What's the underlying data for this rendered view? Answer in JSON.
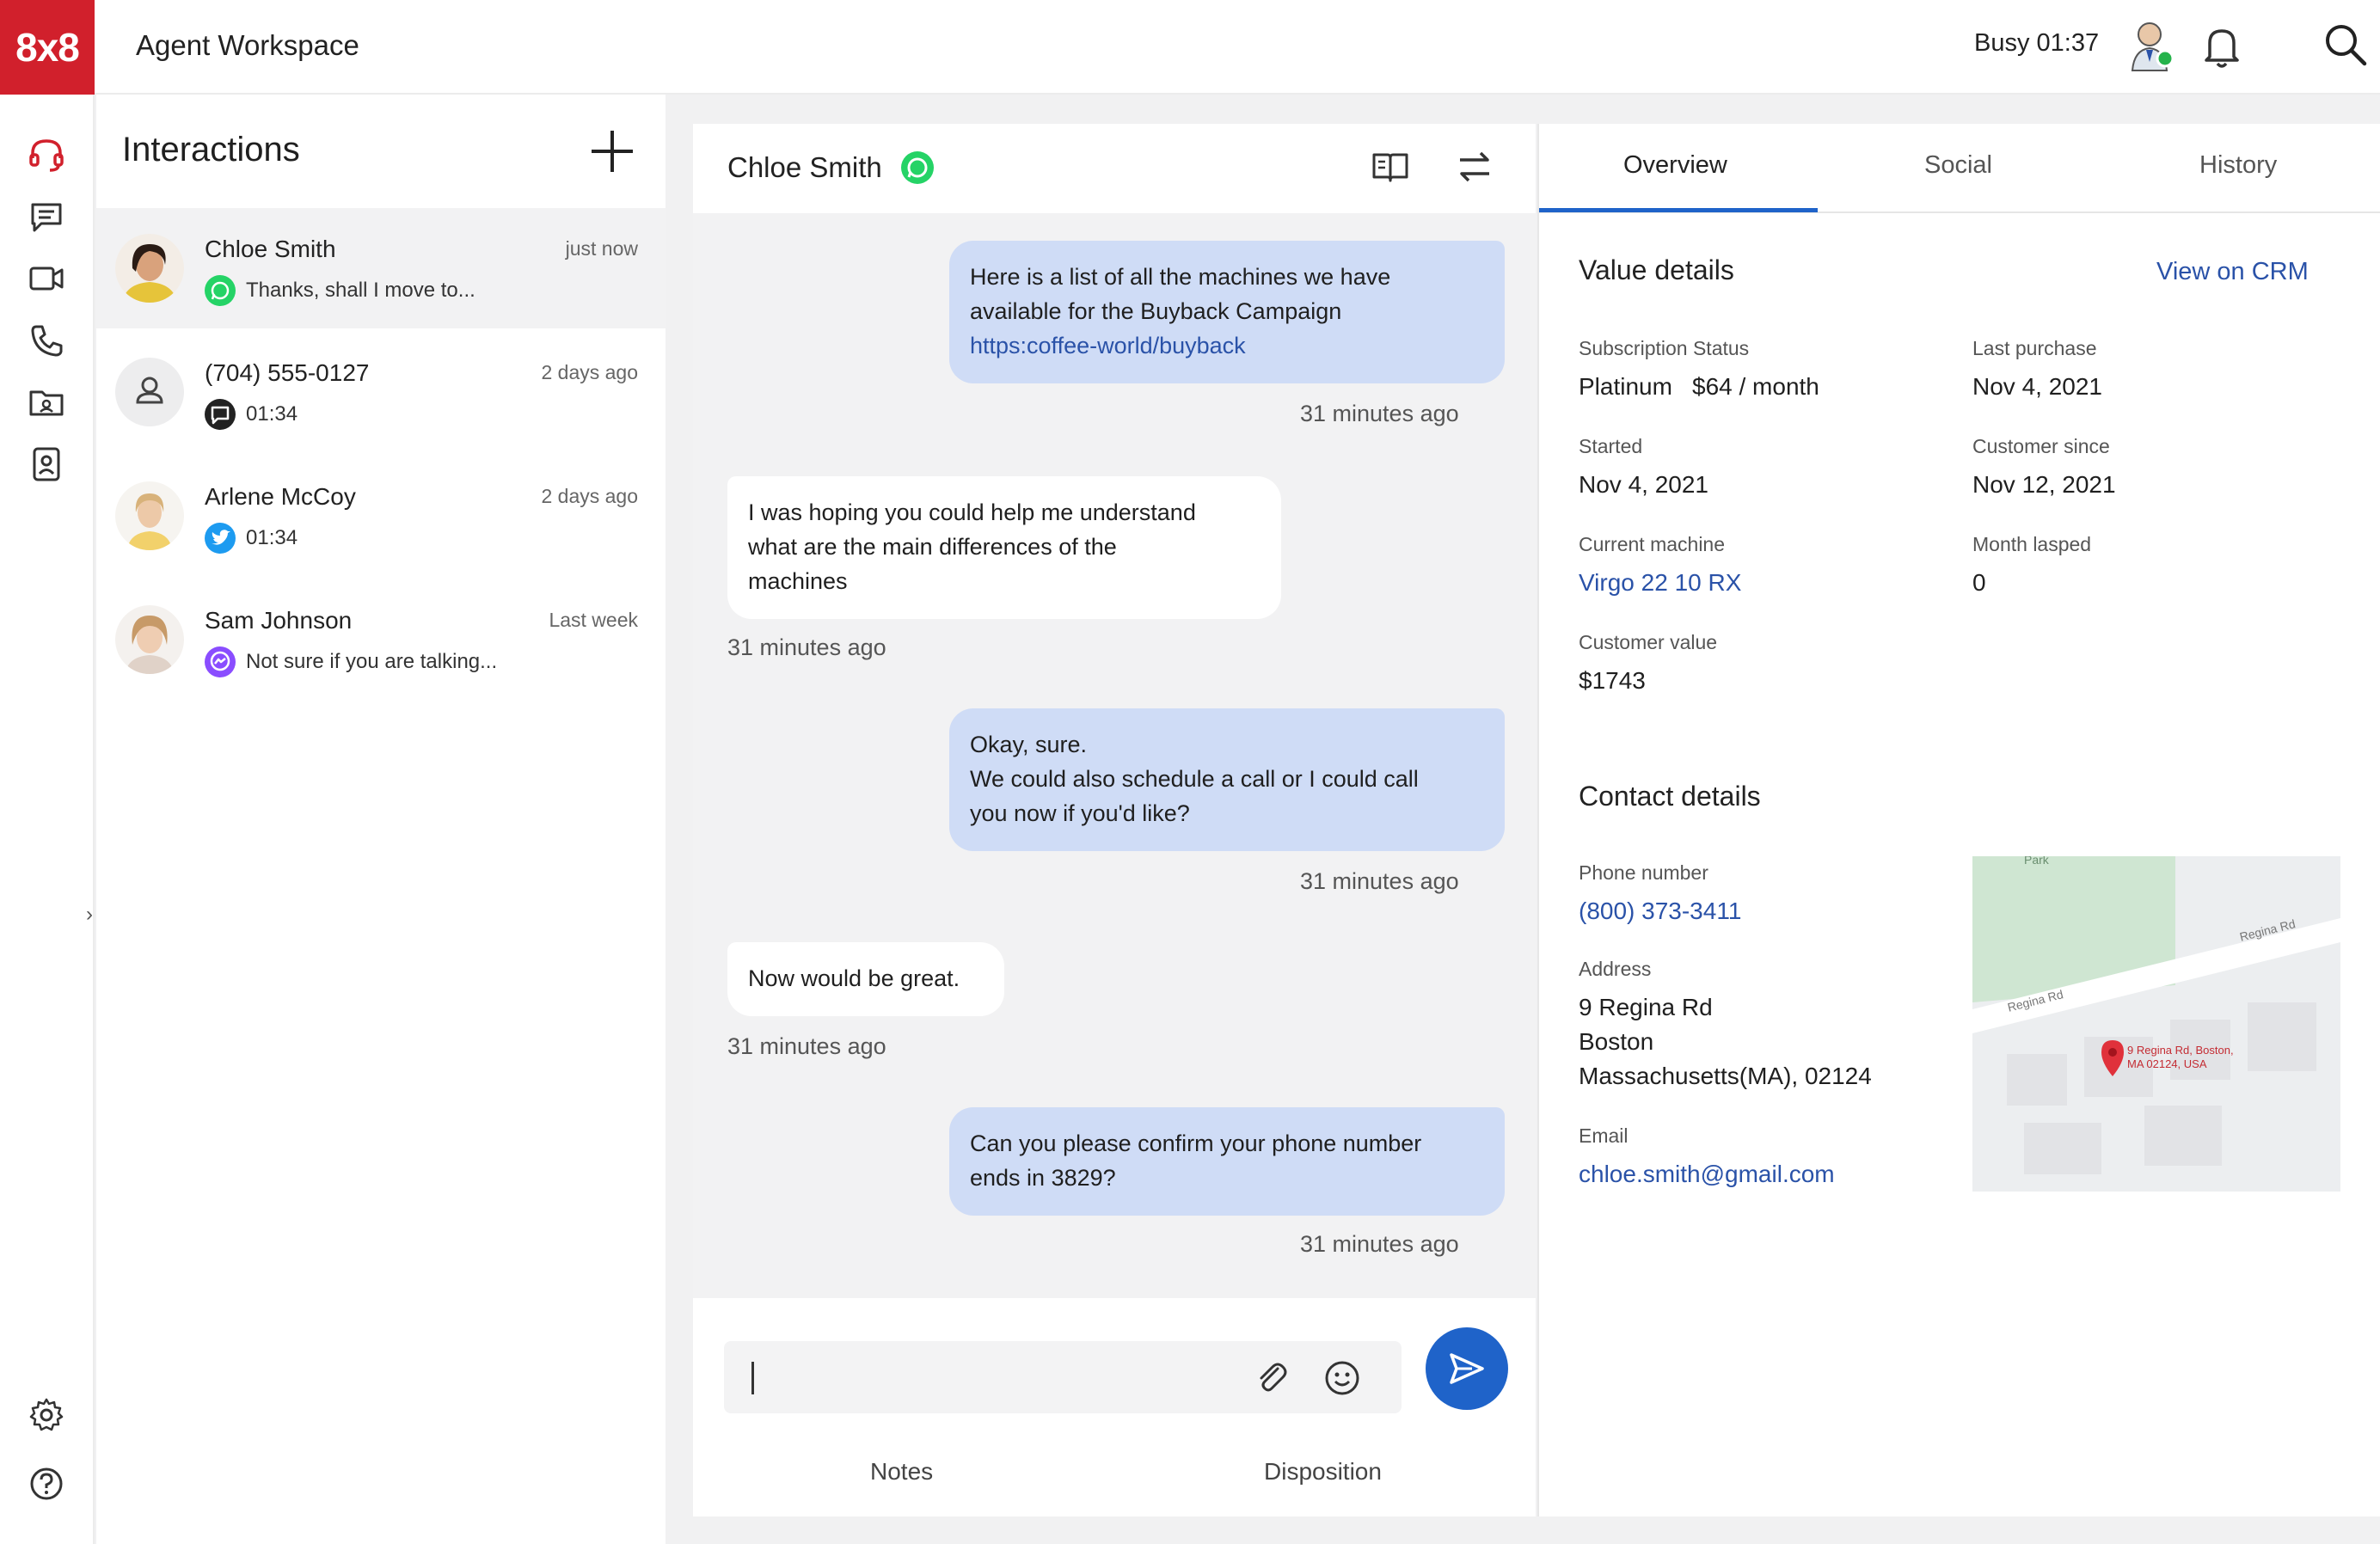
{
  "app": {
    "logo": "8x8",
    "title": "Agent Workspace",
    "status": "Busy 01:37"
  },
  "icons": {
    "user_status": "agent-avatar-icon",
    "notifications": "bell-icon",
    "search": "search-icon"
  },
  "rail": {
    "items": [
      "headset-icon",
      "chat-icon",
      "video-icon",
      "phone-icon",
      "folder-icon",
      "contacts-icon",
      "settings-icon",
      "help-icon"
    ]
  },
  "interactions": {
    "title": "Interactions",
    "items": [
      {
        "name": "Chloe Smith",
        "time": "just now",
        "channel": "whatsapp",
        "preview": "Thanks, shall I move to..."
      },
      {
        "name": "(704) 555-0127",
        "time": "2 days ago",
        "channel": "sms",
        "preview": "01:34"
      },
      {
        "name": "Arlene McCoy",
        "time": "2 days ago",
        "channel": "twitter",
        "preview": "01:34"
      },
      {
        "name": "Sam Johnson",
        "time": "Last week",
        "channel": "messenger",
        "preview": "Not sure if you are talking..."
      }
    ]
  },
  "chat": {
    "contact": "Chloe Smith",
    "messages": [
      {
        "dir": "out",
        "lines": [
          "Here is a list of all the machines we have",
          "available for the Buyback Campaign"
        ],
        "link": "https:coffee-world/buyback",
        "time": "31 minutes ago"
      },
      {
        "dir": "in",
        "lines": [
          "I was hoping you could help me understand",
          "what are the main differences of the",
          "machines"
        ],
        "time": "31 minutes ago"
      },
      {
        "dir": "out",
        "lines": [
          "Okay, sure.",
          "We could also schedule a call or I could call",
          "you now if you'd like?"
        ],
        "time": "31 minutes ago"
      },
      {
        "dir": "in",
        "lines": [
          "Now would be great."
        ],
        "time": "31 minutes ago"
      },
      {
        "dir": "out",
        "lines": [
          "Can you please confirm your phone number",
          "ends in 3829?"
        ],
        "time": "31 minutes ago"
      }
    ],
    "composer": {
      "value": "",
      "notes_tab": "Notes",
      "disposition_tab": "Disposition"
    }
  },
  "details": {
    "tabs": [
      "Overview",
      "Social",
      "History"
    ],
    "active_tab": "Overview",
    "value_section": {
      "title": "Value details",
      "crm_link": "View on CRM",
      "subscription_status_label": "Subscription Status",
      "subscription_status_value": "Platinum",
      "subscription_price": "$64 / month",
      "last_purchase_label": "Last purchase",
      "last_purchase_value": "Nov 4, 2021",
      "started_label": "Started",
      "started_value": "Nov 4, 2021",
      "customer_since_label": "Customer since",
      "customer_since_value": "Nov 12, 2021",
      "current_machine_label": "Current machine",
      "current_machine_value": "Virgo 22 10 RX",
      "month_lapsed_label": "Month lasped",
      "month_lapsed_value": "0",
      "customer_value_label": "Customer value",
      "customer_value_value": "$1743"
    },
    "contact_section": {
      "title": "Contact details",
      "phone_label": "Phone number",
      "phone_value": "(800) 373-3411",
      "address_label": "Address",
      "address_lines": [
        "9 Regina Rd",
        "Boston",
        "Massachusetts(MA), 02124"
      ],
      "email_label": "Email",
      "email_value": "chloe.smith@gmail.com"
    },
    "map": {
      "park_label": "Park",
      "road_label_1": "Regina Rd",
      "road_label_2": "Regina Rd",
      "pin_line_1": "9 Regina Rd, Boston,",
      "pin_line_2": "MA 02124, USA"
    }
  },
  "colors": {
    "brand": "#d1202c",
    "accent": "#1f63c9",
    "link": "#2a52a8",
    "outgoing_bubble": "#cfdcf6",
    "whatsapp": "#25d366",
    "twitter": "#1d9bf0",
    "messenger": "#8a4dff"
  }
}
